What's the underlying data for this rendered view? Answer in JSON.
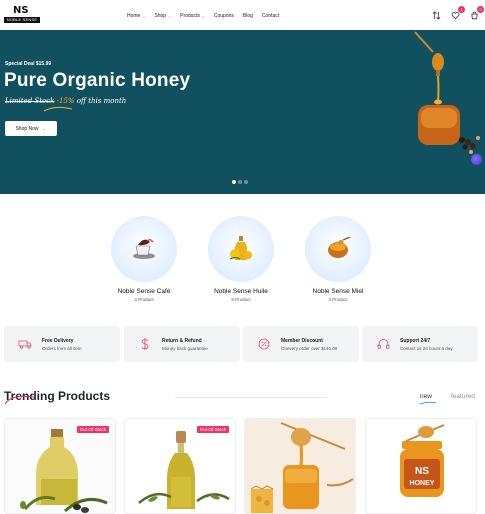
{
  "header": {
    "logo_mark": "NS",
    "logo_sub": "NOBLE SENSE",
    "nav": [
      {
        "label": "Home",
        "dropdown": true
      },
      {
        "label": "Shop",
        "dropdown": true
      },
      {
        "label": "Products",
        "dropdown": true
      },
      {
        "label": "Coupons",
        "dropdown": false
      },
      {
        "label": "Blog",
        "dropdown": false
      },
      {
        "label": "Contact",
        "dropdown": false
      }
    ],
    "wishlist_count": "1",
    "cart_count": "0"
  },
  "hero": {
    "deal": "Special Deal $15.99",
    "title": "Pure Organic Honey",
    "sub_strike": "Limited Stock",
    "sub_pct": "-15%",
    "sub_rest": "off this month",
    "button": "Shop Now",
    "slides": 3,
    "active_slide": 0,
    "bg_color": "#11505e"
  },
  "categories": [
    {
      "name": "Noble Sense Café",
      "count": "3 Product",
      "icon": "coffee-cup-icon"
    },
    {
      "name": "Noble Sense Huile",
      "count": "5 Product",
      "icon": "oil-bottle-icon"
    },
    {
      "name": "Noble Sense Miel",
      "count": "3 Product",
      "icon": "honey-bowl-icon"
    }
  ],
  "features": [
    {
      "title": "Free Delivery",
      "desc": "Orders from all item",
      "icon": "truck-icon"
    },
    {
      "title": "Return & Refund",
      "desc": "Money back guarantee",
      "icon": "dollar-icon"
    },
    {
      "title": "Member Discount",
      "desc": "Onevery order over $140.00",
      "icon": "discount-icon"
    },
    {
      "title": "Support 24/7",
      "desc": "Contact us 24 hours a day",
      "icon": "headset-icon"
    }
  ],
  "trending": {
    "title": "Trending Products",
    "tabs": [
      "new",
      "featured"
    ],
    "active_tab": "new"
  },
  "products": [
    {
      "badge": "Out-Of-Stock",
      "image": "olive-oil-jug"
    },
    {
      "badge": "Out-Of-Stock",
      "image": "olive-oil-bottle"
    },
    {
      "badge": "",
      "image": "honey-jar-dipper"
    },
    {
      "badge": "",
      "image": "ns-honey-jar"
    }
  ],
  "colors": {
    "accent": "#f2345c",
    "badge": "#f0346a",
    "honey": "#e8961e"
  }
}
